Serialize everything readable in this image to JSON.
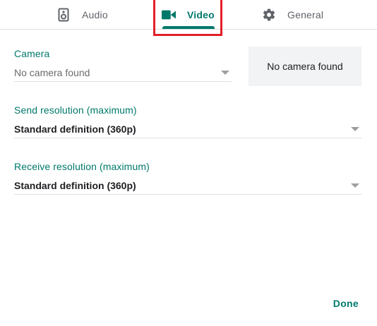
{
  "tabs": {
    "audio": {
      "label": "Audio",
      "icon": "speaker-icon"
    },
    "video": {
      "label": "Video",
      "icon": "videocam-icon",
      "active": true
    },
    "general": {
      "label": "General",
      "icon": "gear-icon"
    }
  },
  "camera": {
    "label": "Camera",
    "value": "No camera found",
    "preview_text": "No camera found"
  },
  "send_resolution": {
    "label": "Send resolution (maximum)",
    "value": "Standard definition (360p)"
  },
  "receive_resolution": {
    "label": "Receive resolution (maximum)",
    "value": "Standard definition (360p)"
  },
  "footer": {
    "done_label": "Done"
  },
  "colors": {
    "accent": "#00796b",
    "inactive_text": "#5f6368",
    "highlight": "#e2202a",
    "preview_bg": "#f1f3f4"
  }
}
